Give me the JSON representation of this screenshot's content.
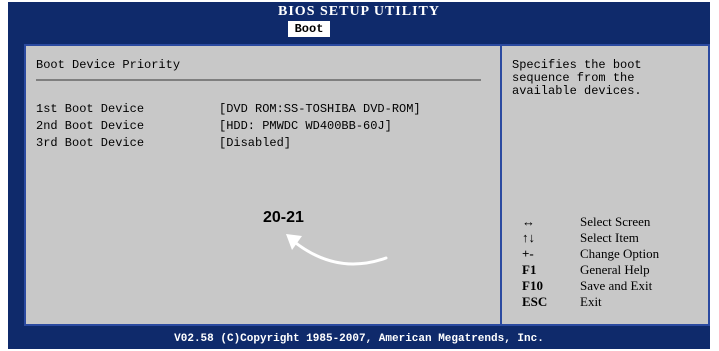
{
  "header": {
    "title": "BIOS SETUP UTILITY",
    "active_tab": "Boot"
  },
  "main": {
    "section_title": "Boot Device Priority",
    "devices": [
      {
        "label": "1st Boot Device",
        "value": "[DVD ROM:SS-TOSHIBA DVD-ROM]"
      },
      {
        "label": "2nd Boot Device",
        "value": "[HDD: PMWDC WD400BB-60J]"
      },
      {
        "label": "3rd Boot Device",
        "value": "[Disabled]"
      }
    ],
    "annotation_label": "20-21"
  },
  "help": {
    "text": "Specifies the boot\nsequence from the\navailable devices.",
    "legend": [
      {
        "key": "↔",
        "desc": "Select Screen"
      },
      {
        "key": "↑↓",
        "desc": "Select Item"
      },
      {
        "key": "+-",
        "desc": "Change Option"
      },
      {
        "key": "F1",
        "desc": "General Help"
      },
      {
        "key": "F10",
        "desc": "Save and Exit"
      },
      {
        "key": "ESC",
        "desc": "Exit"
      }
    ]
  },
  "footer": {
    "copyright": "V02.58 (C)Copyright 1985-2007, American Megatrends, Inc."
  },
  "colors": {
    "frame": "#0f2a6b",
    "panel": "#c8c8c8",
    "border": "#2b4aa0",
    "text": "#000000",
    "title_text": "#ffffff"
  }
}
